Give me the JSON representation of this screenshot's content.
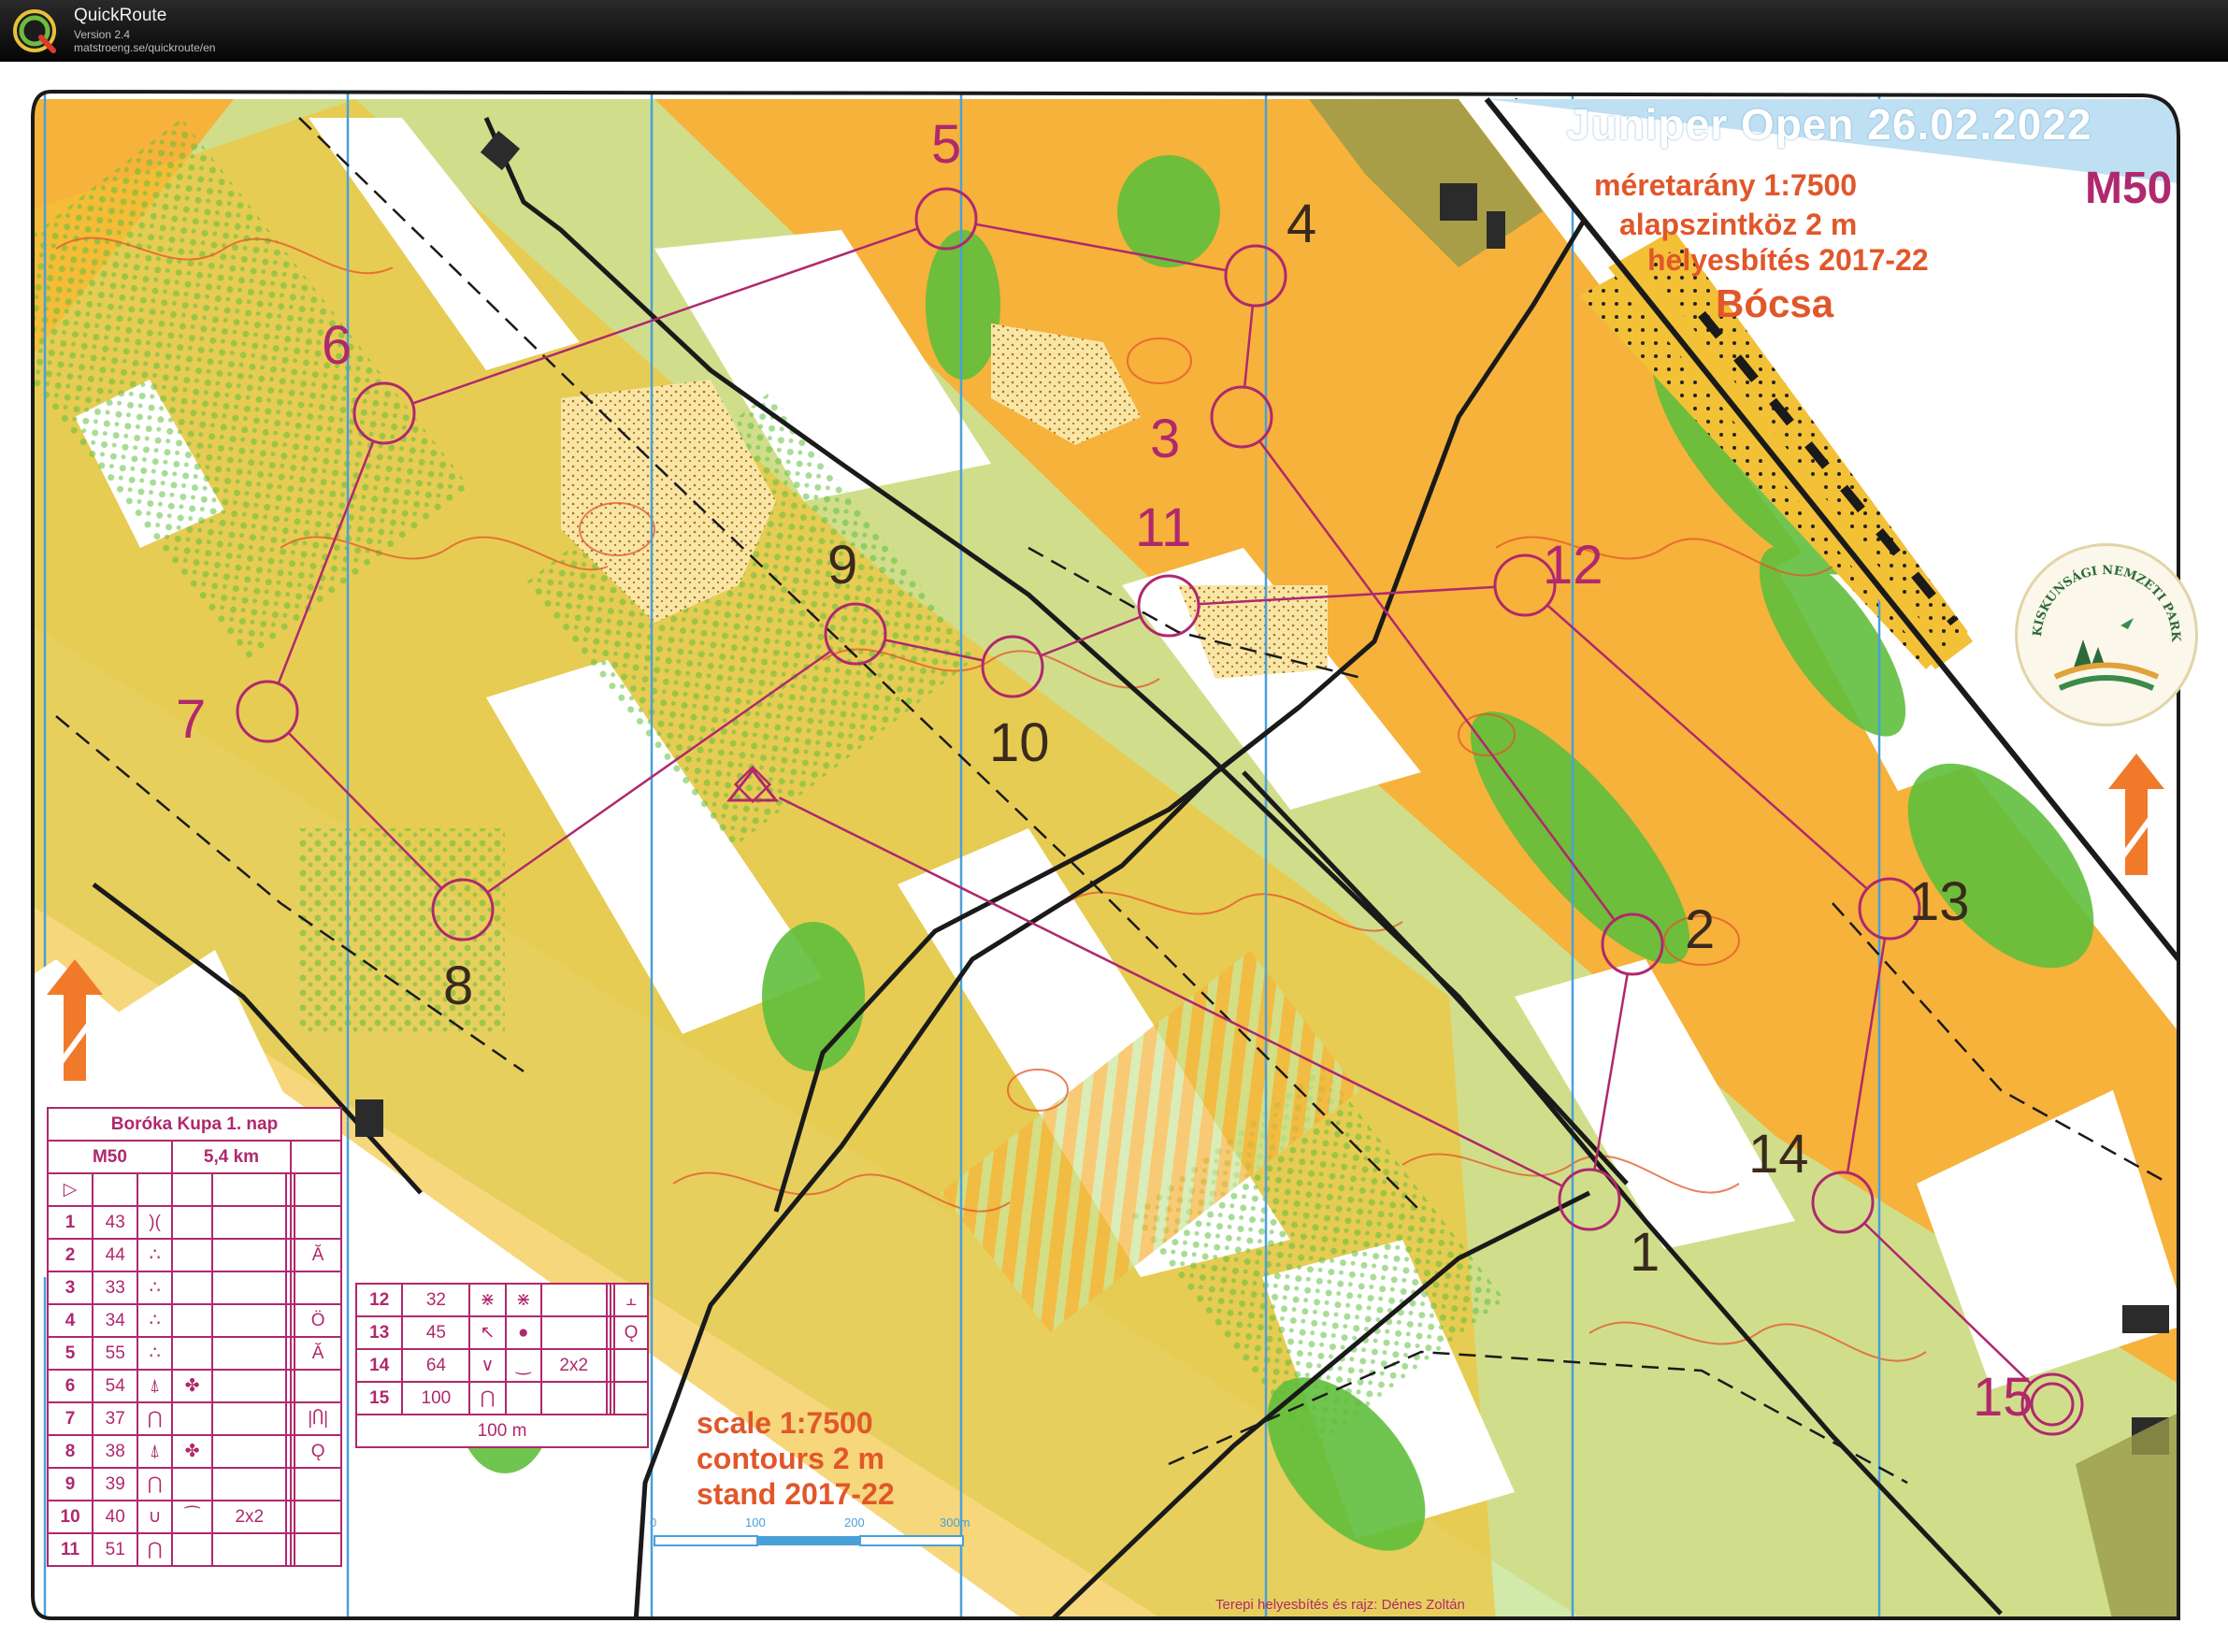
{
  "window": {
    "app_name": "QuickRoute",
    "version": "Version 2.4",
    "url": "matstroeng.se/quickroute/en",
    "logo_letter": "Q"
  },
  "map": {
    "event_title": "Juniper Open 26.02.2022",
    "class": "M50",
    "scale_hu": "méretarány   1:7500",
    "contour_hu": "alapszintköz      2 m",
    "stand_hu": "helyesbítés  2017-22",
    "place": "Bócsa",
    "scale_en": "scale    1:7500",
    "contours_en": "contours   2 m",
    "stand_en": "stand   2017-22",
    "scalebar_labels": [
      "0",
      "100",
      "200",
      "300m"
    ],
    "scalebar_legend": "100 m",
    "credit": "Terepi helyesbítés és rajz: Dénes Zoltán",
    "park_logo_text": "KISKUNSÁGI NEMZETI PARK",
    "colors": {
      "control": "#b0286e",
      "vegetation_light": "#c9e59a",
      "vegetation_dark": "#5fbf3c",
      "open_land": "#f6b23a",
      "contour": "#e1572a",
      "water": "#4aa0d8",
      "header_band": "#bfe0f3"
    },
    "controls": [
      {
        "n": "1"
      },
      {
        "n": "2"
      },
      {
        "n": "3"
      },
      {
        "n": "4"
      },
      {
        "n": "5"
      },
      {
        "n": "6"
      },
      {
        "n": "7"
      },
      {
        "n": "8"
      },
      {
        "n": "9"
      },
      {
        "n": "10"
      },
      {
        "n": "11"
      },
      {
        "n": "12"
      },
      {
        "n": "13"
      },
      {
        "n": "14"
      },
      {
        "n": "15"
      }
    ]
  },
  "description": {
    "event": "Boróka Kupa 1. nap",
    "class": "M50",
    "length": "5,4 km",
    "rows": [
      {
        "n": "1",
        "code": "43",
        "c": ")(",
        "g": ""
      },
      {
        "n": "2",
        "code": "44",
        "c": "∴",
        "g": "Ă"
      },
      {
        "n": "3",
        "code": "33",
        "c": "∴",
        "g": ""
      },
      {
        "n": "4",
        "code": "34",
        "c": "∴",
        "g": "Ö"
      },
      {
        "n": "5",
        "code": "55",
        "c": "∴",
        "g": "Ă"
      },
      {
        "n": "6",
        "code": "54",
        "c": "⍋",
        "d": "✤",
        "g": ""
      },
      {
        "n": "7",
        "code": "37",
        "c": "⋂",
        "g": "|Ⴖ|"
      },
      {
        "n": "8",
        "code": "38",
        "c": "⍋",
        "d": "✤",
        "g": "Ǫ"
      },
      {
        "n": "9",
        "code": "39",
        "c": "⋂",
        "g": ""
      },
      {
        "n": "10",
        "code": "40",
        "c": "∪",
        "d": "⁀",
        "e": "2x2",
        "g": ""
      },
      {
        "n": "11",
        "code": "51",
        "c": "⋂",
        "g": ""
      }
    ],
    "rows2": [
      {
        "n": "12",
        "code": "32",
        "c": "⋇",
        "d": "⋇",
        "g": "⫠"
      },
      {
        "n": "13",
        "code": "45",
        "c": "↖",
        "d": "●",
        "g": "Ǫ"
      },
      {
        "n": "14",
        "code": "64",
        "c": "∨",
        "d": "‿",
        "e": "2x2",
        "g": ""
      },
      {
        "n": "15",
        "code": "100",
        "c": "⋂",
        "g": ""
      }
    ]
  }
}
